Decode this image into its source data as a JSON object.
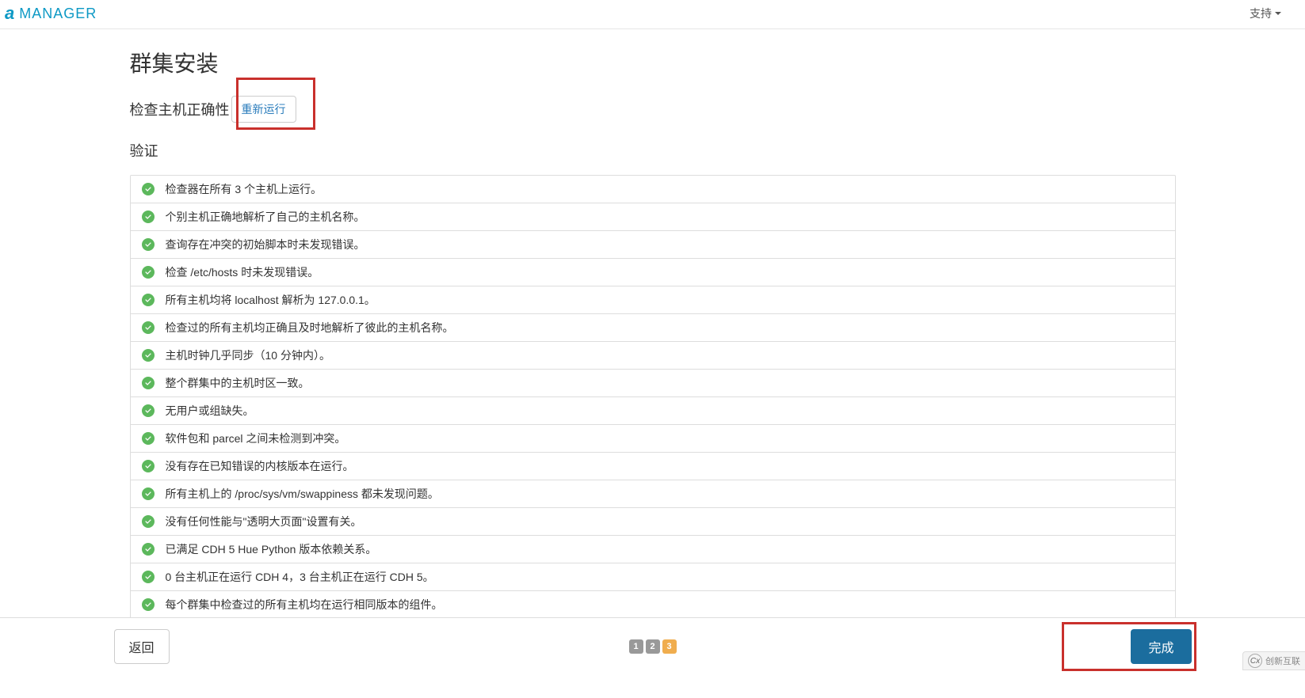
{
  "header": {
    "brand_text": "MANAGER",
    "support_label": "支持"
  },
  "page": {
    "title": "群集安装",
    "subtitle": "检查主机正确性",
    "rerun_button": "重新运行",
    "verify_header": "验证"
  },
  "checks": [
    {
      "text": "检查器在所有 3 个主机上运行。"
    },
    {
      "text": "个别主机正确地解析了自己的主机名称。"
    },
    {
      "text": "查询存在冲突的初始脚本时未发现错误。"
    },
    {
      "text": "检查 /etc/hosts 时未发现错误。"
    },
    {
      "text": "所有主机均将 localhost 解析为 127.0.0.1。"
    },
    {
      "text": "检查过的所有主机均正确且及时地解析了彼此的主机名称。"
    },
    {
      "text": "主机时钟几乎同步（10 分钟内）。"
    },
    {
      "text": "整个群集中的主机时区一致。"
    },
    {
      "text": "无用户或组缺失。"
    },
    {
      "text": "软件包和 parcel 之间未检测到冲突。"
    },
    {
      "text": "没有存在已知错误的内核版本在运行。"
    },
    {
      "text": "所有主机上的 /proc/sys/vm/swappiness 都未发现问题。"
    },
    {
      "text": "没有任何性能与\"透明大页面\"设置有关。"
    },
    {
      "text": "已满足 CDH 5 Hue Python 版本依赖关系。"
    },
    {
      "text": "0 台主机正在运行 CDH 4，3 台主机正在运行 CDH 5。"
    },
    {
      "text": "每个群集中检查过的所有主机均在运行相同版本的组件。"
    }
  ],
  "footer": {
    "back_button": "返回",
    "finish_button": "完成",
    "pages": [
      "1",
      "2",
      "3"
    ],
    "active_page": 2
  },
  "watermark": {
    "text": "创新互联"
  }
}
